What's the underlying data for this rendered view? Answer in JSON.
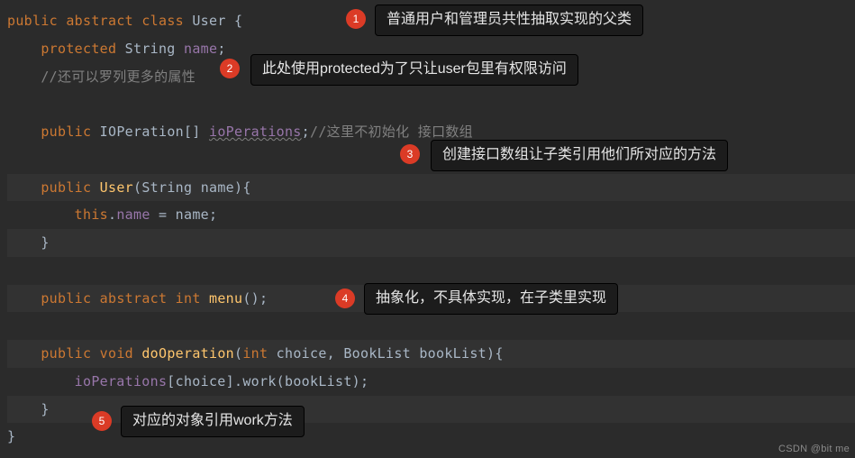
{
  "code": {
    "l1": {
      "kw1": "public",
      "kw2": "abstract",
      "kw3": "class",
      "name": "User",
      "brace": " {"
    },
    "l2": {
      "kw": "protected",
      "type": "String",
      "field": "name",
      "semi": ";"
    },
    "l3": {
      "comment": "//还可以罗列更多的属性"
    },
    "l5": {
      "kw": "public",
      "type": "IOPeration[]",
      "field": "ioPerations",
      "semi": ";",
      "comment": "//这里不初始化 接口数组"
    },
    "l7": {
      "kw": "public",
      "ctor": "User",
      "lp": "(",
      "ptype": "String",
      "pname": "name",
      "rp": ")",
      "brace": "{"
    },
    "l8": {
      "this": "this",
      "dot": ".",
      "field": "name",
      "eq": " = ",
      "param": "name",
      "semi": ";"
    },
    "l9": {
      "brace": "}"
    },
    "l11": {
      "kw1": "public",
      "kw2": "abstract",
      "ret": "int",
      "method": "menu",
      "paren": "()",
      "semi": ";"
    },
    "l13": {
      "kw1": "public",
      "kw2": "void",
      "method": "doOperation",
      "lp": "(",
      "t1": "int",
      "p1": "choice",
      "comma": ", ",
      "t2": "BookList",
      "p2": "bookList",
      "rp": ")",
      "brace": "{"
    },
    "l14": {
      "field": "ioPerations",
      "lb": "[",
      "idx": "choice",
      "rb": "]",
      "dot": ".",
      "call": "work",
      "lp": "(",
      "arg": "bookList",
      "rp": ")",
      "semi": ";"
    },
    "l15": {
      "brace": "}"
    },
    "l16": {
      "brace": "}"
    }
  },
  "annotations": {
    "a1": {
      "num": "1",
      "text": "普通用户和管理员共性抽取实现的父类"
    },
    "a2": {
      "num": "2",
      "text": "此处使用protected为了只让user包里有权限访问"
    },
    "a3": {
      "num": "3",
      "text": "创建接口数组让子类引用他们所对应的方法"
    },
    "a4": {
      "num": "4",
      "text": "抽象化，不具体实现，在子类里实现"
    },
    "a5": {
      "num": "5",
      "text": "对应的对象引用work方法"
    }
  },
  "watermark": "CSDN @bit me"
}
